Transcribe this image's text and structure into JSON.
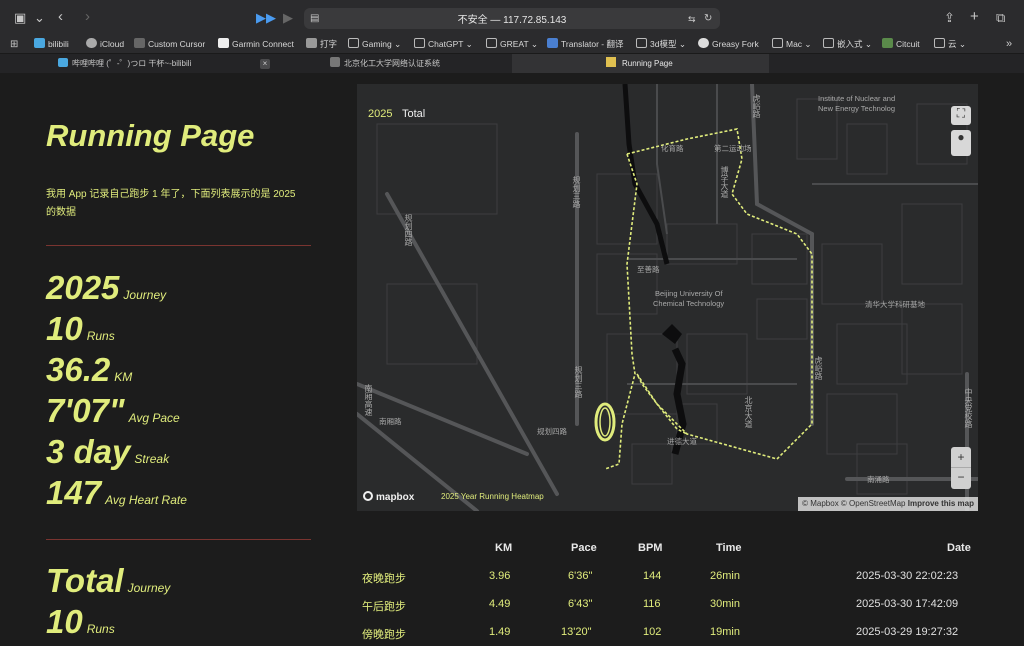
{
  "browser": {
    "url": "不安全 — 117.72.85.143",
    "bookmarks": [
      "bilibili",
      "iCloud",
      "Custom Cursor",
      "Garmin Connect",
      "打字",
      "Gaming",
      "ChatGPT",
      "GREAT",
      "Translator - 翻译",
      "3d模型",
      "Greasy Fork",
      "Mac",
      "嵌入式",
      "Citcuit",
      "云"
    ],
    "tabs": [
      {
        "label": "哔哩哔哩 (゜-゜)つロ 干杯~-bilibili"
      },
      {
        "label": "北京化工大学网络认证系统"
      },
      {
        "label": "Running Page"
      }
    ]
  },
  "page": {
    "title": "Running Page",
    "description": "我用 App 记录自己跑步 1 年了，下面列表展示的是 2025 的数据",
    "year_stats": [
      {
        "value": "2025",
        "label": "Journey"
      },
      {
        "value": "10",
        "label": "Runs"
      },
      {
        "value": "36.2",
        "label": "KM"
      },
      {
        "value": "7'07\"",
        "label": "Avg Pace"
      },
      {
        "value": "3 day",
        "label": "Streak"
      },
      {
        "value": "147",
        "label": "Avg Heart Rate"
      }
    ],
    "total_stats": [
      {
        "value": "Total",
        "label": "Journey"
      },
      {
        "value": "10",
        "label": "Runs"
      }
    ]
  },
  "map": {
    "year": "2025",
    "filter": "Total",
    "logo": "mapbox",
    "caption": "2025 Year Running Heatmap",
    "attribution": "© Mapbox © OpenStreetMap",
    "improve": "Improve this map",
    "labels": {
      "institute1": "Institute of Nuclear and",
      "institute2": "New Energy Technolog",
      "huayulu": "化育路",
      "sport": "第二运动场",
      "zhishan": "至善路",
      "buct1": "Beijing University Of",
      "buct2": "Chemical Technology",
      "qinghua": "清华大学科研基地",
      "nanyong": "南涌路",
      "bd": "北京大道",
      "hulue_top": "虎峪路",
      "hulue_mid": "虎峪路",
      "guihua3_top": "规划三路",
      "guihua3_mid": "规划三路",
      "guihua4": "规划四路",
      "guihua4_b": "规划四路",
      "nanhua": "南厢高速",
      "nanlu": "南厢路",
      "zhongyang": "中央党校路",
      "boxue": "博学大道",
      "jinde": "进德大道"
    },
    "icons": {
      "fullscreen": "fullscreen-icon",
      "style": "lightbulb-icon",
      "zoom_in": "+",
      "zoom_out": "−"
    },
    "route_color": "#e0ec7c"
  },
  "table": {
    "headers": {
      "km": "KM",
      "pace": "Pace",
      "bpm": "BPM",
      "time": "Time",
      "date": "Date"
    },
    "rows": [
      {
        "name": "夜晚跑步",
        "km": "3.96",
        "pace": "6'36\"",
        "bpm": "144",
        "time": "26min",
        "date": "2025-03-30 22:02:23"
      },
      {
        "name": "午后跑步",
        "km": "4.49",
        "pace": "6'43\"",
        "bpm": "116",
        "time": "30min",
        "date": "2025-03-30 17:42:09"
      },
      {
        "name": "傍晚跑步",
        "km": "1.49",
        "pace": "13'20\"",
        "bpm": "102",
        "time": "19min",
        "date": "2025-03-29 19:27:32"
      }
    ]
  },
  "colors": {
    "accent": "#e0ec7c",
    "background": "#1c1c1c",
    "divider": "#7a3430"
  }
}
